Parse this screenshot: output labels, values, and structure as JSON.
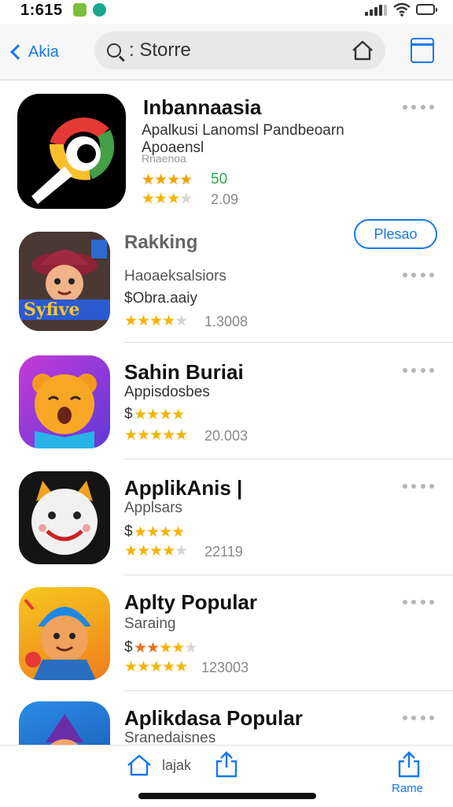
{
  "status_bar": {
    "time": "1:615"
  },
  "nav": {
    "back_label": "Akia",
    "search_text": ": Storre"
  },
  "apps": [
    {
      "title": "Inbannaasia",
      "line1": "Apalkusi Lanomsl Pandbeoarn",
      "line2": "Apoaensl",
      "line3": "Rnaenoa",
      "rating_value": "50",
      "rating_count": "2.09",
      "stars_a": 4,
      "stars_b": 3
    },
    {
      "title": "Rakking",
      "action_label": "Plesao",
      "line1": "Haoaeksalsiors",
      "line2": "$Obra.aaiy",
      "rating_count": "1.3008",
      "stars_b": 4
    },
    {
      "title": "Sahin Buriai",
      "line1": "Appisdosbes",
      "line2": "$",
      "rating_count": "20.003",
      "stars_a": 4,
      "stars_b": 5
    },
    {
      "title": "ApplikAnis |",
      "line1": "Applsars",
      "line2": "$",
      "rating_count": "22119",
      "stars_a": 4,
      "stars_b": 4
    },
    {
      "title": "Aplty Popular",
      "line1": "Saraing",
      "line2": "$",
      "rating_count": "123003",
      "stars_a": 4,
      "stars_b": 5
    },
    {
      "title": "Aplikdasa Popular",
      "line1": "Sranedaisnes"
    }
  ],
  "toolbar": {
    "label": "lajak",
    "share_label": "Rame"
  },
  "colors": {
    "accent": "#1478f0",
    "star": "#f4b400",
    "rating_green": "#2fa84f"
  }
}
